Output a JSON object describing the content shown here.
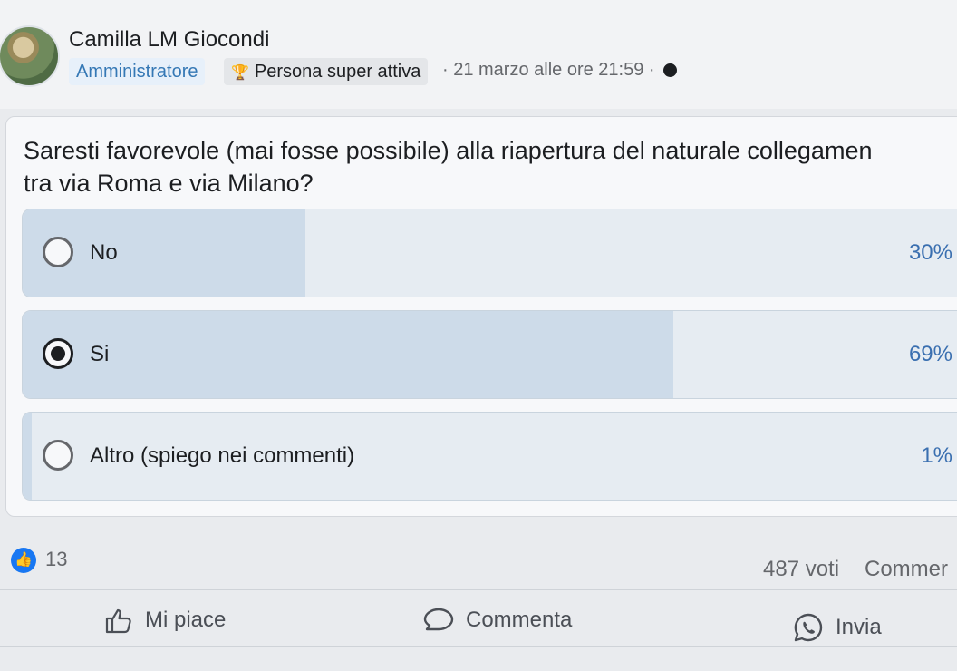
{
  "post": {
    "author": "Camilla LM Giocondi",
    "badge_admin": "Amministratore",
    "badge_active": "Persona super attiva",
    "timestamp": "· 21 marzo alle ore 21:59 ·",
    "privacy_icon": "globe-icon"
  },
  "poll": {
    "question": "Saresti favorevole (mai fosse possibile) alla riapertura del naturale collegamen\ntra via Roma e via Milano?",
    "options": [
      {
        "label": "No",
        "percent": "30%",
        "fill": 0.3,
        "selected": false
      },
      {
        "label": "Si",
        "percent": "69%",
        "fill": 0.69,
        "selected": true
      },
      {
        "label": "Altro (spiego nei commenti)",
        "percent": "1%",
        "fill": 0.01,
        "selected": false
      }
    ]
  },
  "stats": {
    "likes": "13",
    "votes": "487 voti",
    "comments": "Commer"
  },
  "actions": {
    "like": "Mi piace",
    "comment": "Commenta",
    "send": "Invia"
  },
  "colors": {
    "accent": "#1877f2",
    "percent_text": "#3a6fb0"
  }
}
